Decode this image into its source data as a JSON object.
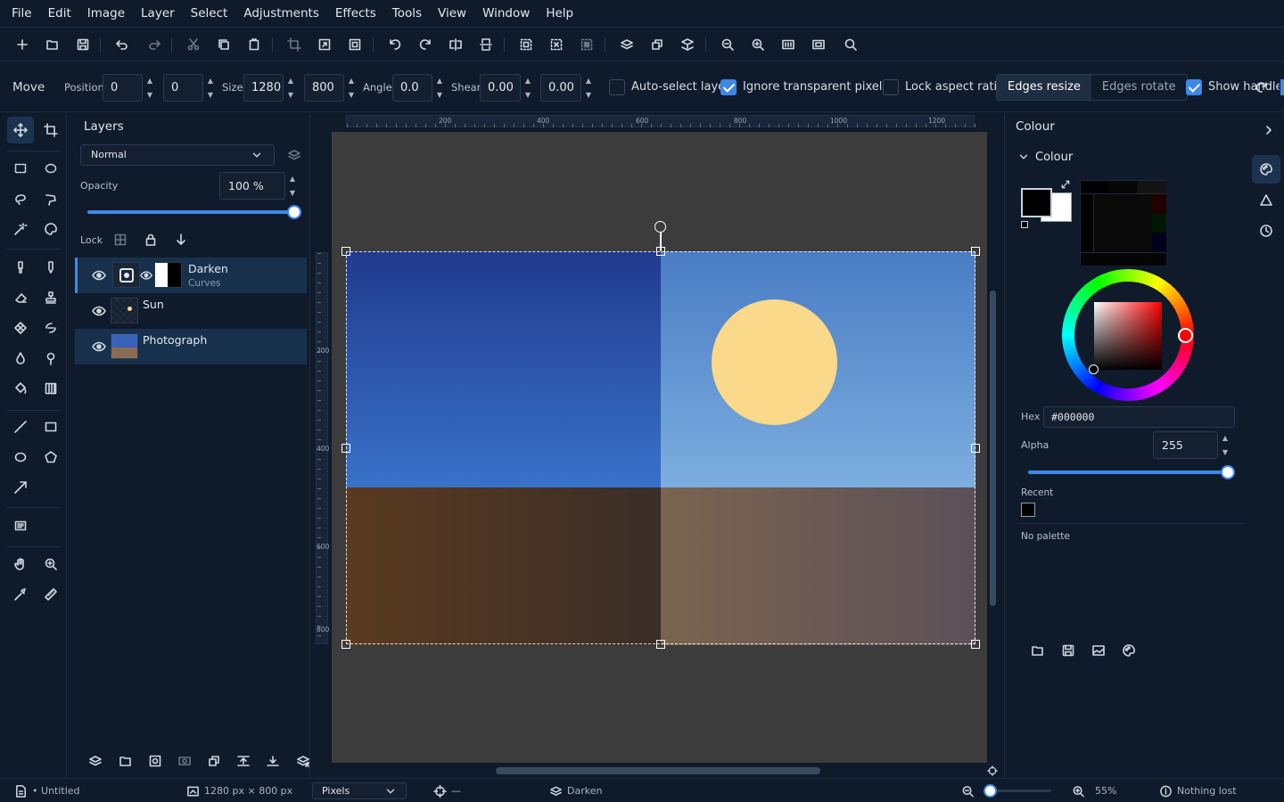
{
  "menu": [
    "File",
    "Edit",
    "Image",
    "Layer",
    "Select",
    "Adjustments",
    "Effects",
    "Tools",
    "View",
    "Window",
    "Help"
  ],
  "toolbar": {
    "icons": [
      "new-icon",
      "open-icon",
      "save-icon",
      "undo-icon",
      "redo-icon",
      "cut-icon",
      "copy-icon",
      "paste-icon",
      "crop-to-selection-icon",
      "resize-image-icon",
      "canvas-size-icon",
      "rotate-ccw-icon",
      "rotate-cw-icon",
      "flip-horizontal-icon",
      "flip-vertical-icon",
      "select-all-icon",
      "deselect-icon",
      "invert-selection-icon",
      "add-layer-icon",
      "duplicate-layer-icon",
      "merge-layer-icon",
      "zoom-out-icon",
      "zoom-in-icon",
      "actual-size-icon",
      "best-fit-icon",
      "search-icon"
    ]
  },
  "options": {
    "tool_label": "Move",
    "position_label": "Position",
    "pos_x": "0",
    "pos_y": "0",
    "size_label": "Size",
    "width": "1280",
    "height": "800",
    "angle_label": "Angle",
    "angle": "0.0",
    "shear_label": "Shear",
    "shear_x": "0.00",
    "shear_y": "0.00",
    "auto_select": "Auto-select layer",
    "auto_select_checked": false,
    "ignore_transparent": "Ignore transparent pixels",
    "ignore_transparent_checked": true,
    "lock_aspect": "Lock aspect ratio",
    "lock_aspect_checked": false,
    "edges_resize": "Edges resize",
    "edges_rotate": "Edges rotate",
    "show_handles": "Show handles",
    "show_handles_checked": true
  },
  "layers": {
    "title": "Layers",
    "blend_mode": "Normal",
    "opacity_label": "Opacity",
    "opacity_value": "100 %",
    "opacity": 1.0,
    "lock_label": "Lock",
    "items": [
      {
        "name": "Darken",
        "sub": "Curves",
        "selected": true
      },
      {
        "name": "Sun",
        "sub": "",
        "selected": false
      },
      {
        "name": "Photograph",
        "sub": "",
        "selected": true
      }
    ]
  },
  "ruler": {
    "h_ticks": [
      "200",
      "400",
      "600",
      "800",
      "1000",
      "1200"
    ],
    "v_ticks": [
      "200",
      "400",
      "600",
      "800"
    ]
  },
  "colour": {
    "panel_title": "Colour",
    "section_title": "Colour",
    "primary": "#000000",
    "secondary": "#ffffff",
    "hex_label": "Hex",
    "hex_value": "#000000",
    "alpha_label": "Alpha",
    "alpha_value": "255",
    "alpha": 1.0,
    "recent_label": "Recent",
    "recent_colors": [
      "#000000"
    ],
    "palette_text": "No palette"
  },
  "canvas_colors": {
    "sky_left_top": "#213a8e",
    "sky_left_bottom": "#3872c8",
    "sky_right_top": "#4a7cc4",
    "sky_right_bottom": "#7caee0",
    "ground_left": "#5a3a20",
    "ground_mid": "#3a2e28",
    "ground_right_a": "#7a6450",
    "ground_right_b": "#5c5058",
    "sun": "#fbd98a"
  },
  "status": {
    "document": "• Untitled",
    "image_size": "1280 px × 800 px",
    "units": "Pixels",
    "cursor_pos": "—",
    "active_layer": "Darken",
    "zoom": "55%",
    "zoom_fraction": 0.55,
    "history": "Nothing lost"
  }
}
